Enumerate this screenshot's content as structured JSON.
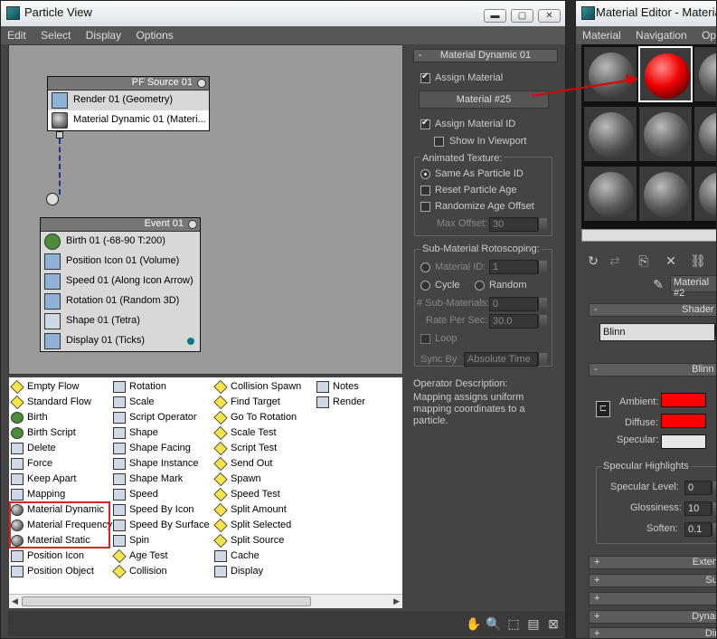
{
  "particle_view": {
    "title": "Particle View",
    "menu": [
      "Edit",
      "Select",
      "Display",
      "Options"
    ],
    "pf_source": {
      "title": "PF Source 01",
      "ops": [
        "Render 01 (Geometry)",
        "Material Dynamic 01 (Materi..."
      ]
    },
    "event": {
      "title": "Event 01",
      "ops": [
        "Birth 01 (-68-90 T:200)",
        "Position Icon 01 (Volume)",
        "Speed 01 (Along Icon Arrow)",
        "Rotation 01 (Random 3D)",
        "Shape 01 (Tetra)",
        "Display 01 (Ticks)"
      ]
    },
    "depot": {
      "col1": [
        "Empty Flow",
        "Standard Flow",
        "Birth",
        "Birth Script",
        "Delete",
        "Force",
        "Keep Apart",
        "Mapping",
        "Material Dynamic",
        "Material Frequency",
        "Material Static",
        "Position Icon",
        "Position Object"
      ],
      "col2": [
        "Rotation",
        "Scale",
        "Script Operator",
        "Shape",
        "Shape Facing",
        "Shape Instance",
        "Shape Mark",
        "Speed",
        "Speed By Icon",
        "Speed By Surface",
        "Spin",
        "Age Test",
        "Collision"
      ],
      "col3": [
        "Collision Spawn",
        "Find Target",
        "Go To Rotation",
        "Scale Test",
        "Script Test",
        "Send Out",
        "Spawn",
        "Speed Test",
        "Split Amount",
        "Split Selected",
        "Split Source",
        "Cache",
        "Display"
      ],
      "col4": [
        "Notes",
        "Render"
      ]
    },
    "params": {
      "rollout": "Material Dynamic 01",
      "assign_material": "Assign Material",
      "material_btn": "Material #25",
      "assign_id": "Assign Material ID",
      "show_vp": "Show In Viewport",
      "anim_tex": "Animated Texture:",
      "same_as": "Same As Particle ID",
      "reset_age": "Reset Particle Age",
      "rand_age": "Randomize Age Offset",
      "max_offset": "Max Offset:",
      "max_offset_val": "30",
      "sub_mat": "Sub-Material Rotoscoping:",
      "mat_id": "Material ID:",
      "mat_id_val": "1",
      "cycle": "Cycle",
      "random": "Random",
      "sub_count": "# Sub-Materials:",
      "sub_count_val": "0",
      "rate": "Rate Per Sec:",
      "rate_val": "30.0",
      "loop": "Loop",
      "sync": "Sync By",
      "sync_val": "Absolute Time"
    },
    "desc_title": "Operator Description:",
    "desc": "Mapping assigns uniform mapping coordinates to a particle."
  },
  "material_editor": {
    "title": "Material Editor - Material",
    "menu": [
      "Material",
      "Navigation",
      "Opt"
    ],
    "mat_name": "Material #2",
    "shader_head": "Shader B",
    "shader": "Blinn",
    "blinn_head": "Blinn B",
    "ambient": "Ambient:",
    "diffuse": "Diffuse:",
    "specular": "Specular:",
    "spec_hl": "Specular Highlights",
    "spec_level": "Specular Level:",
    "spec_level_val": "0",
    "gloss": "Glossiness:",
    "gloss_val": "10",
    "soften": "Soften:",
    "soften_val": "0.1",
    "rollouts": [
      "Extend",
      "Sup",
      "",
      "Dynam",
      "Dire"
    ],
    "colors": {
      "ambient": "#ff0000",
      "diffuse": "#ff0000",
      "specular": "#e6e6e6"
    }
  }
}
